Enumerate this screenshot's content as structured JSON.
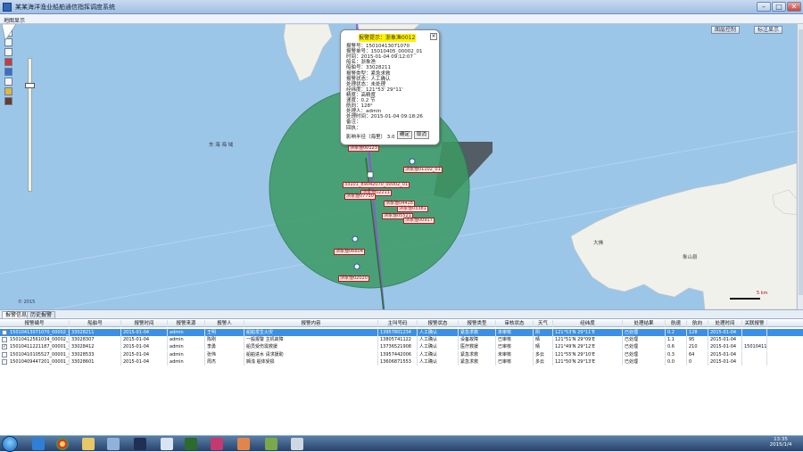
{
  "window": {
    "title": "某某海洋渔业船舶通信指挥调度系统",
    "icon": "app-icon",
    "controls": [
      "–",
      "□",
      "✕"
    ]
  },
  "map_panel": {
    "header": "地图显示",
    "buttons": [
      "图层控制",
      "标注显示"
    ],
    "sea_label": "东 海 海 域",
    "island_label": "象山县",
    "island_label2": "大佛",
    "scale_label": "5 km",
    "watermark": "© 2015",
    "vessel_tags": [
      "浙象渔00123",
      "浙象渔01102_01",
      "33101_89042070_00002_01",
      "浙象渔02211",
      "浙象渔04416",
      "浙象渔03381",
      "浙象渔05521",
      "浙象渔07730",
      "浙象渔00917",
      "浙象渔06604",
      "浙象渔02020"
    ]
  },
  "popup": {
    "title": "报警提示：浙象渔00123",
    "lines": [
      "报警号：15010413071070",
      "报警单号：15010405_00002_01",
      "时间：2015-01-04 09:12:07",
      "船名：浙象渔",
      "船舶号：33028211",
      "报警类型：紧急求救",
      "报警状态：人工确认",
      "处理状态：未处理",
      "经纬度：121°53'  29°11'",
      "精度：高精度",
      "速度：0.2 节",
      "航向：128°",
      "处理人：admin",
      "处理时间：2015-01-04 09:18:26",
      "备注：",
      "回执："
    ],
    "footer": "影响半径（海里）",
    "footer_value": "3.0",
    "btn_ok": "确定",
    "btn_cancel": "取消"
  },
  "tabs": [
    "报警信息",
    "历史报警"
  ],
  "grid": {
    "columns": [
      "报警编号",
      "船舶号",
      "报警时间",
      "报警来源",
      "报警人",
      "报警内容",
      "主叫号码",
      "报警状态",
      "报警类型",
      "审核状态",
      "天气",
      "经纬度",
      "处理结果",
      "航速",
      "航向",
      "处理时间",
      "关联报警"
    ],
    "rows": [
      [
        "15010413071070_00002_01",
        "33028211",
        "2015-01-04",
        "admin",
        "王明",
        "船舶发生火灾",
        "13957801234",
        "人工确认",
        "紧急求救",
        "未审核",
        "阴",
        "121°53'N 29°11'E",
        "已处理",
        "0.2",
        "128",
        "2015-01-04",
        ""
      ],
      [
        "15010412561034_00002_01",
        "33028307",
        "2015-01-04",
        "admin",
        "陈刚",
        "一般报警 主机故障",
        "13805741122",
        "人工确认",
        "设备故障",
        "已审核",
        "晴",
        "121°51'N 29°09'E",
        "已处理",
        "1.1",
        "95",
        "2015-01-04",
        ""
      ],
      [
        "15010411221187_00001_01",
        "33028412",
        "2015-01-04",
        "admin",
        "李勇",
        "船员受伤需救援",
        "13736521908",
        "人工确认",
        "医疗救援",
        "已审核",
        "晴",
        "121°49'N 29°12'E",
        "已处理",
        "0.6",
        "210",
        "2015-01-04",
        "15010411"
      ],
      [
        "15010410105527_00001_01",
        "33028533",
        "2015-01-04",
        "admin",
        "张伟",
        "船舶进水 请求援助",
        "13957442006",
        "人工确认",
        "紧急求救",
        "未审核",
        "多云",
        "121°55'N 29°10'E",
        "已处理",
        "0.3",
        "64",
        "2015-01-04",
        ""
      ],
      [
        "15010409447201_00001_01",
        "33028601",
        "2015-01-04",
        "admin",
        "周杰",
        "搁浅 船体受损",
        "13606871553",
        "人工确认",
        "紧急求救",
        "已审核",
        "多云",
        "121°50'N 29°13'E",
        "已处理",
        "0.0",
        "0",
        "2015-01-04",
        ""
      ]
    ]
  },
  "taskbar": {
    "time": "13:35",
    "date": "2015/1/4"
  }
}
